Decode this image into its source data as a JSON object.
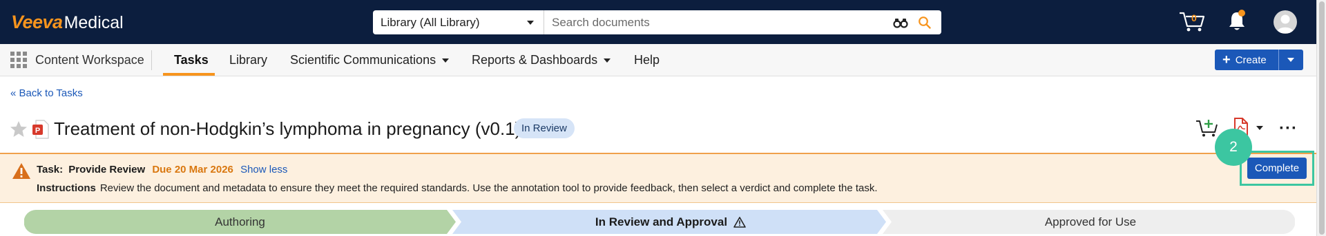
{
  "brand": {
    "veeva": "Veeva",
    "medical": "Medical",
    "accent": "#f7941d",
    "nav_bg": "#0c1e3e"
  },
  "search": {
    "scope_value": "Library (All Library)",
    "placeholder": "Search documents"
  },
  "header": {
    "cart_count": "0",
    "icons": [
      "binoculars-icon",
      "search-icon",
      "cart-icon",
      "bell-icon",
      "avatar"
    ]
  },
  "nav": {
    "workspace": "Content Workspace",
    "items": [
      {
        "label": "Tasks",
        "active": true
      },
      {
        "label": "Library"
      },
      {
        "label": "Scientific Communications",
        "dropdown": true
      },
      {
        "label": "Reports & Dashboards",
        "dropdown": true
      },
      {
        "label": "Help"
      }
    ],
    "create_label": "Create"
  },
  "back_link": "« Back to Tasks",
  "document": {
    "title": "Treatment of non-Hodgkin’s lymphoma in pregnancy (v0.1)",
    "status": "In Review"
  },
  "task": {
    "label": "Task:",
    "name": "Provide Review",
    "due": "Due 20 Mar 2026",
    "toggle": "Show less",
    "instructions_label": "Instructions",
    "instructions": "Review the document and metadata to ensure they meet the required standards. Use the annotation tool to provide feedback, then select a verdict and complete the task.",
    "complete_label": "Complete",
    "step_number": "2"
  },
  "lifecycle": {
    "stages": [
      {
        "label": "Authoring",
        "color": "#b3d3a6"
      },
      {
        "label": "In Review and Approval",
        "color": "#cfe0f7",
        "current": true
      },
      {
        "label": "Approved for Use",
        "color": "#eeeeee"
      }
    ]
  }
}
